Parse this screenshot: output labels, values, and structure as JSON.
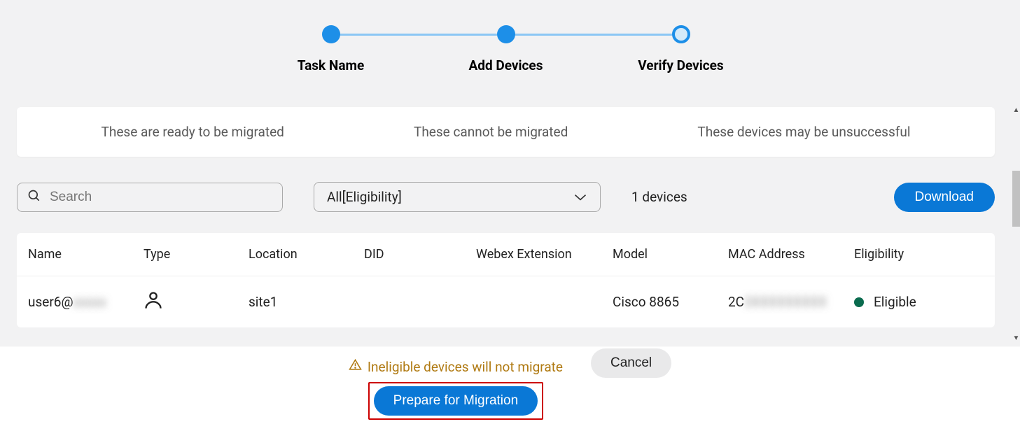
{
  "stepper": {
    "steps": [
      {
        "label": "Task Name"
      },
      {
        "label": "Add Devices"
      },
      {
        "label": "Verify Devices"
      }
    ]
  },
  "status": {
    "ready": "These are ready to be migrated",
    "cannot": "These cannot be migrated",
    "maybe": "These devices may be unsuccessful"
  },
  "search": {
    "placeholder": "Search",
    "value": ""
  },
  "filter": {
    "selected": "All[Eligibility]"
  },
  "count_label": "1 devices",
  "download_label": "Download",
  "table": {
    "headers": [
      "Name",
      "Type",
      "Location",
      "DID",
      "Webex Extension",
      "Model",
      "MAC Address",
      "Eligibility"
    ],
    "rows": [
      {
        "name_visible": "user6@",
        "name_blurred": "xxxxx",
        "type_icon": "person-icon",
        "location": "site1",
        "did": "",
        "webex_ext": "",
        "model": "Cisco 8865",
        "mac_visible": "2C",
        "mac_blurred": "3XXXXXXXXX",
        "eligibility": "Eligible",
        "eligibility_color": "#0a6b4e"
      }
    ]
  },
  "footer": {
    "warning": "Ineligible devices will not migrate",
    "prepare": "Prepare for Migration",
    "cancel": "Cancel"
  }
}
